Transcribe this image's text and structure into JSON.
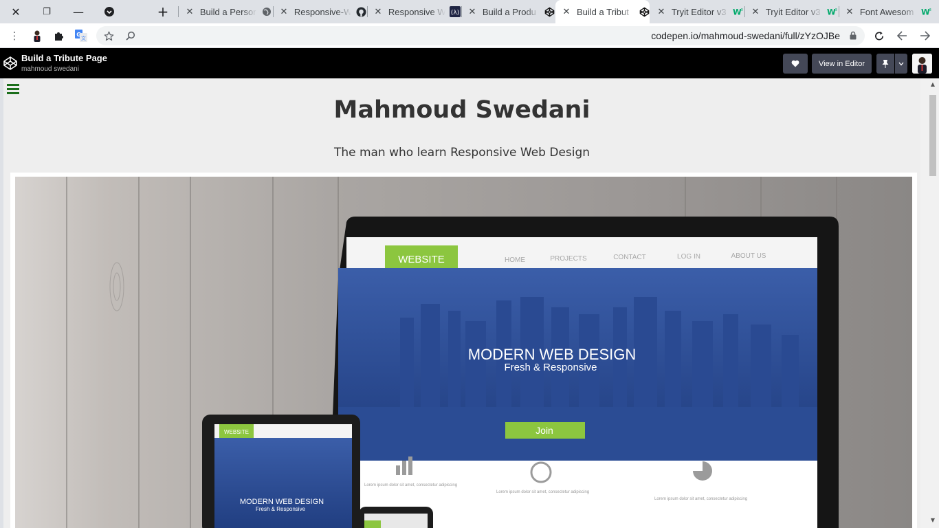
{
  "tabs": [
    {
      "title": "Build a Persor",
      "favicon": "globe-icon"
    },
    {
      "title": "Responsive-W",
      "favicon": "github-icon"
    },
    {
      "title": "Responsive W",
      "favicon": "codecademy-icon"
    },
    {
      "title": "Build a Produ",
      "favicon": "codepen-icon"
    },
    {
      "title": "Build a Tribut",
      "favicon": "codepen-icon",
      "active": true
    },
    {
      "title": "Tryit Editor v3",
      "favicon": "w3schools-icon"
    },
    {
      "title": "Tryit Editor v3",
      "favicon": "w3schools-icon"
    },
    {
      "title": "Font Awesom",
      "favicon": "w3schools-icon"
    }
  ],
  "omnibox": {
    "url": "codepen.io/mahmoud-swedani/full/zYzOJBe"
  },
  "codepen": {
    "pen_title": "Build a Tribute Page",
    "author": "mahmoud swedani",
    "view_in_editor": "View in Editor"
  },
  "page": {
    "title": "Mahmoud Swedani",
    "subtitle": "The man who learn Responsive Web Design"
  },
  "hero_image": {
    "logo": "WEBSITE",
    "nav": [
      "HOME",
      "PROJECTS",
      "CONTACT",
      "LOG IN",
      "ABOUT US"
    ],
    "headline": "MODERN WEB DESIGN",
    "tagline": "Fresh & Responsive",
    "cta": "Join",
    "tablet_logo": "WEBSITE",
    "tablet_headline": "MODERN WEB DESIGN",
    "tablet_tagline": "Fresh & Responsive",
    "lorem": "Lorem ipsum dolor sit amet, consectetur adipiscing elit."
  },
  "colors": {
    "codepen_header": "#000000",
    "accent_green": "#8cc63f",
    "screen_blue": "#2d4f9c",
    "hamburger": "#1b6e1b"
  }
}
